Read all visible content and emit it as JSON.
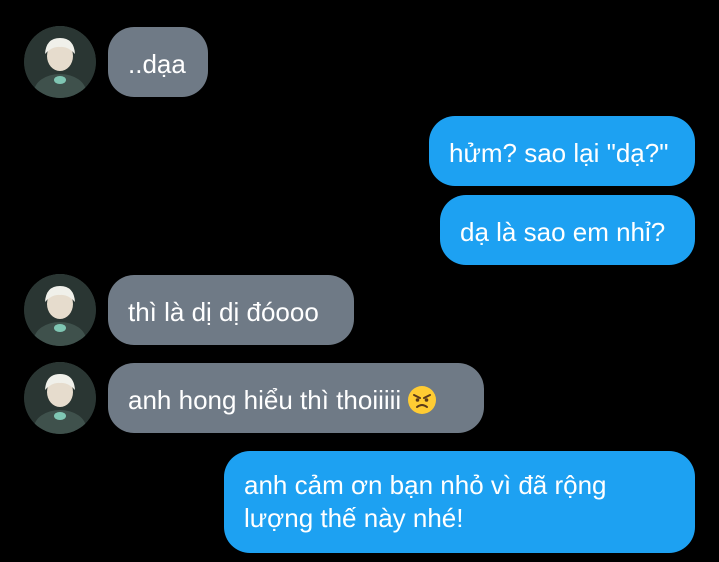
{
  "chat": {
    "messages": [
      {
        "from": "them",
        "text": "..dạa"
      },
      {
        "from": "me",
        "text": "hửm? sao lại \"dạ?\""
      },
      {
        "from": "me",
        "text": "dạ là sao em nhỉ?"
      },
      {
        "from": "them",
        "text": "thì là dị dị đóooo"
      },
      {
        "from": "them",
        "text": "anh hong hiểu thì thoiiiii",
        "emoji": "angry-face-icon"
      },
      {
        "from": "me",
        "text_line1": "anh cảm ơn bạn nhỏ vì đã rộng",
        "text_line2": "lượng thế này nhé!"
      }
    ]
  },
  "colors": {
    "background": "#000000",
    "incoming_bubble": "#6f7a86",
    "outgoing_bubble": "#1da1f2",
    "text": "#ffffff"
  }
}
